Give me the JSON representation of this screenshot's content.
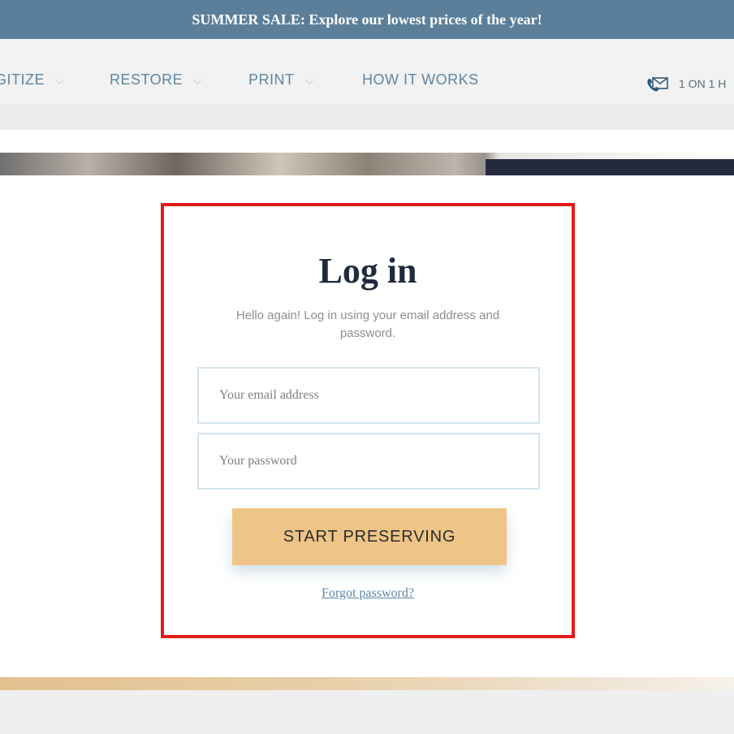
{
  "promo": {
    "text": "SUMMER SALE: Explore our lowest prices of the year!"
  },
  "nav": {
    "items": [
      {
        "label": "GITIZE",
        "has_dropdown": true
      },
      {
        "label": "RESTORE",
        "has_dropdown": true
      },
      {
        "label": "PRINT",
        "has_dropdown": true
      },
      {
        "label": "HOW IT WORKS",
        "has_dropdown": false
      }
    ],
    "contact_label": "1 ON 1 H",
    "contact_icon": "phone-mail-icon"
  },
  "login": {
    "title": "Log in",
    "subtitle": "Hello again! Log in using your email address and password.",
    "email_placeholder": "Your email address",
    "password_placeholder": "Your password",
    "submit_label": "START PRESERVING",
    "forgot_label": "Forgot password?"
  },
  "colors": {
    "promo_bg": "#5b7f9a",
    "nav_text": "#5e87a5",
    "highlight_border": "#e21b1b",
    "button_bg": "#efc487",
    "title_text": "#1f2b3d"
  }
}
